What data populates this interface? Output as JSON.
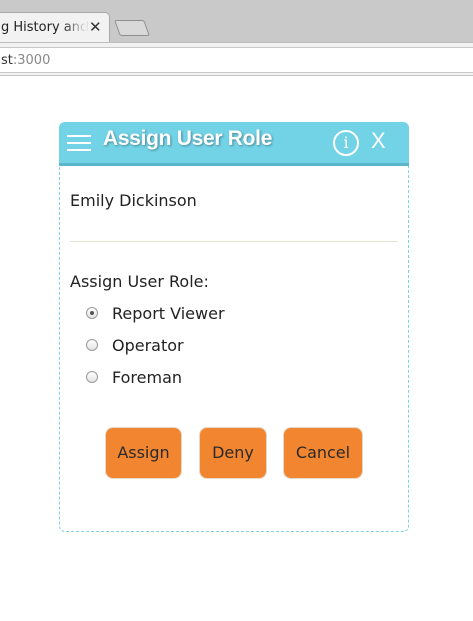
{
  "browser": {
    "tab_title": "g History and Ap",
    "tab_close": "✕",
    "address_host": "st",
    "address_port": ":3000"
  },
  "dialog": {
    "title": "Assign User Role",
    "info_glyph": "i",
    "close_glyph": "X",
    "user_name": "Emily Dickinson",
    "role_prompt": "Assign User Role:",
    "roles": [
      {
        "label": "Report Viewer",
        "selected": true
      },
      {
        "label": "Operator",
        "selected": false
      },
      {
        "label": "Foreman",
        "selected": false
      }
    ],
    "buttons": {
      "assign": "Assign",
      "deny": "Deny",
      "cancel": "Cancel"
    }
  },
  "colors": {
    "header": "#72d2e6",
    "button": "#f28630"
  }
}
